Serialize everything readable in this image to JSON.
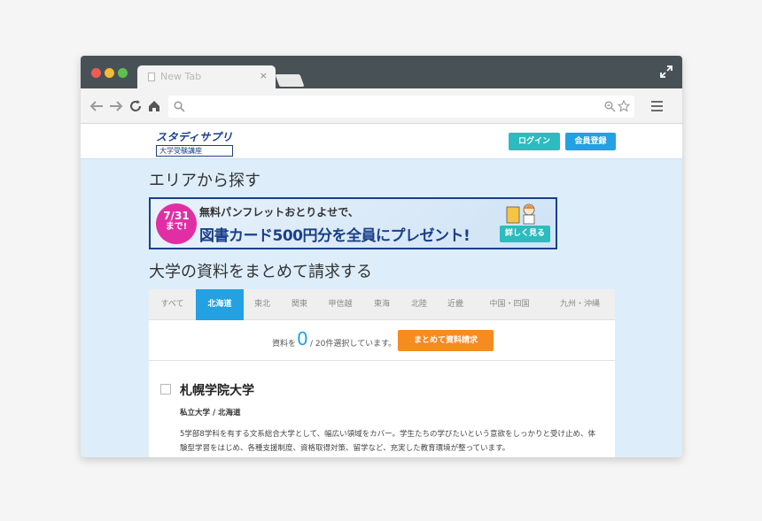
{
  "browser": {
    "tab_title": "New Tab",
    "tab_close": "×",
    "url": "",
    "colors": {
      "titlebar": "#485256",
      "toolbar": "#f3f3f3"
    }
  },
  "site": {
    "logo_main": "スタディサプリ",
    "logo_sub": "大学受験講座",
    "login_label": "ログイン",
    "register_label": "会員登録",
    "colors": {
      "brand": "#1a3f8b",
      "accent": "#23a1e2",
      "teal": "#2cbcbd",
      "orange": "#f68b1f",
      "page_bg": "#ddeefa"
    }
  },
  "area_title": "エリアから探す",
  "banner": {
    "badge_date": "7/31",
    "badge_sub": "まで!",
    "line1": "無料パンフレットおとりよせで、",
    "line2": "図書カード500円分を全員にプレゼント!",
    "button_label": "詳しく見る"
  },
  "materials_title": "大学の資料をまとめて請求する",
  "region_tabs": [
    {
      "label": "すべて",
      "active": false
    },
    {
      "label": "北海道",
      "active": true
    },
    {
      "label": "東北",
      "active": false
    },
    {
      "label": "関東",
      "active": false
    },
    {
      "label": "甲信越",
      "active": false
    },
    {
      "label": "東海",
      "active": false
    },
    {
      "label": "北陸",
      "active": false
    },
    {
      "label": "近畿",
      "active": false
    },
    {
      "label": "中国・四国",
      "active": false
    },
    {
      "label": "九州・沖縄",
      "active": false
    }
  ],
  "selection": {
    "prefix": "資料を",
    "count": "0",
    "suffix": "/ 20件選択しています。",
    "button_label": "まとめて資料請求"
  },
  "university": {
    "name": "札幌学院大学",
    "meta": "私立大学 / 北海道",
    "description": "5学部8学科を有する文系総合大学として、幅広い領域をカバー。学生たちの学びたいという意欲をしっかりと受け止め、体験型学習をはじめ、各種支援制度、資格取得対策、留学など、充実した教育環境が整っています。",
    "checked": false
  }
}
